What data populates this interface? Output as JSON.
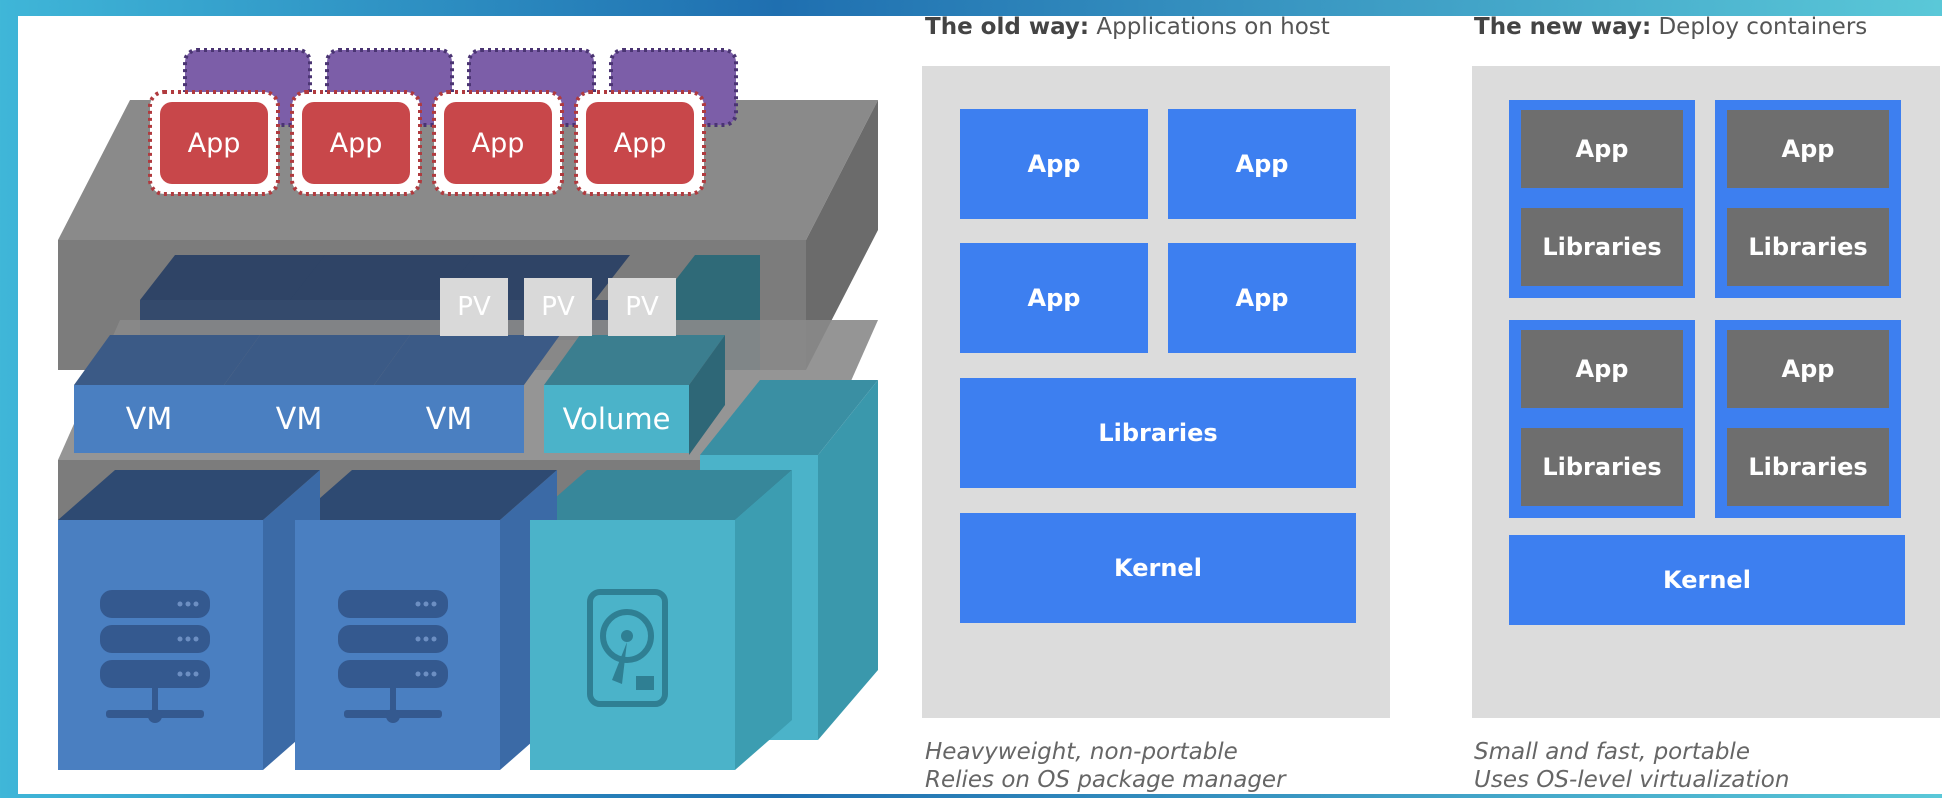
{
  "illustration": {
    "apps": [
      "App",
      "App",
      "App",
      "App"
    ],
    "pvs": [
      "PV",
      "PV",
      "PV"
    ],
    "vms": [
      "VM",
      "VM",
      "VM"
    ],
    "volume": "Volume",
    "icons": [
      "server-icon",
      "server-icon",
      "hard-drive-icon"
    ]
  },
  "old_way": {
    "heading_bold": "The old way:",
    "heading_rest": " Applications on host",
    "apps": [
      "App",
      "App",
      "App",
      "App"
    ],
    "libraries": "Libraries",
    "kernel": "Kernel",
    "caption_line1": "Heavyweight, non-portable",
    "caption_line2": "Relies on OS package manager"
  },
  "new_way": {
    "heading_bold": "The new way:",
    "heading_rest": " Deploy containers",
    "containers": [
      {
        "app": "App",
        "libraries": "Libraries"
      },
      {
        "app": "App",
        "libraries": "Libraries"
      },
      {
        "app": "App",
        "libraries": "Libraries"
      },
      {
        "app": "App",
        "libraries": "Libraries"
      }
    ],
    "kernel": "Kernel",
    "caption_line1": "Small and fast, portable",
    "caption_line2": "Uses OS-level virtualization"
  },
  "colors": {
    "blue": "#3d7ff0",
    "gray_panel": "#dcdcdc",
    "dark_gray": "#6e6e6e",
    "app_red": "#c8474a",
    "app_purple": "#7c5ea8",
    "vm_blue": "#4a7fc1",
    "volume_teal": "#4bb3c9"
  }
}
